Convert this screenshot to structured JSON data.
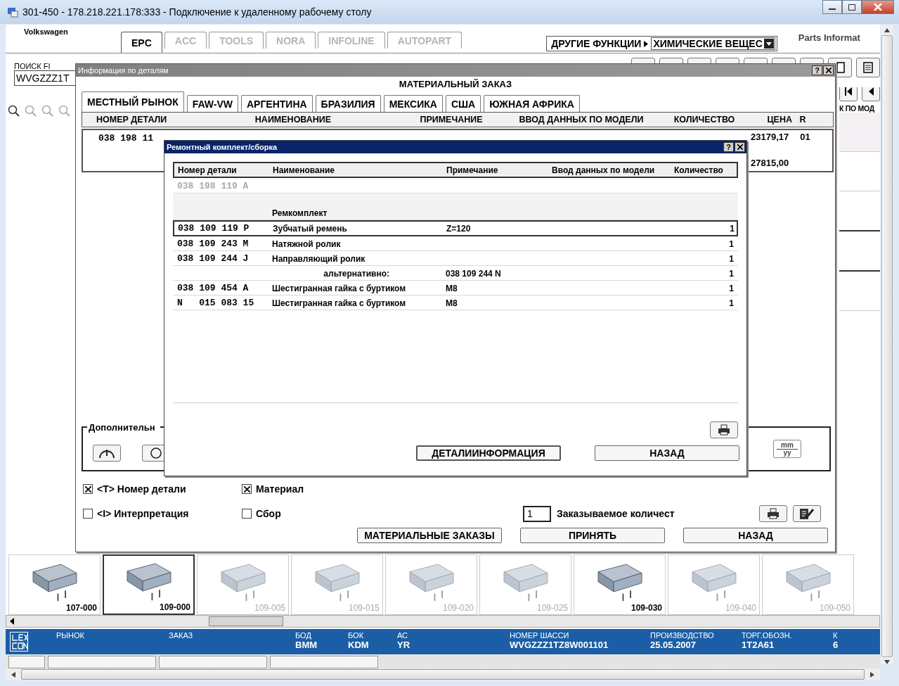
{
  "window": {
    "title": "301-450 - 178.218.221.178:333 - Подключение к удаленному рабочему столу"
  },
  "app": {
    "brand": "Volkswagen",
    "header_right": "Parts Informat",
    "other_functions": "ДРУГИЕ ФУНКЦИИ",
    "dropdown": {
      "value": "ХИМИЧЕСКИЕ ВЕЩЕС"
    },
    "tabs": [
      {
        "label": "EPC",
        "selected": true,
        "disabled": false
      },
      {
        "label": "ACC",
        "selected": false,
        "disabled": true
      },
      {
        "label": "TOOLS",
        "selected": false,
        "disabled": true
      },
      {
        "label": "NORA",
        "selected": false,
        "disabled": true
      },
      {
        "label": "INFOLINE",
        "selected": false,
        "disabled": true
      },
      {
        "label": "AUTOPART",
        "selected": false,
        "disabled": true
      }
    ],
    "search": {
      "label": "ПОИСК FI",
      "value": "WVGZZZ1T"
    },
    "side_column_header": "К ПО МОД"
  },
  "details_dialog": {
    "title": "Информация по деталям",
    "help_button": "?",
    "heading": "МАТЕРИАЛЬНЫЙ ЗАКАЗ",
    "tabs": [
      {
        "label": "МЕСТНЫЙ РЫНОК",
        "selected": true
      },
      {
        "label": "FAW-VW",
        "selected": false
      },
      {
        "label": "АРГЕНТИНА",
        "selected": false
      },
      {
        "label": "БРАЗИЛИЯ",
        "selected": false
      },
      {
        "label": "МЕКСИКА",
        "selected": false
      },
      {
        "label": "США",
        "selected": false
      },
      {
        "label": "ЮЖНАЯ АФРИКА",
        "selected": false
      }
    ],
    "columns": [
      "НОМЕР ДЕТАЛИ",
      "НАИМЕНОВАНИЕ",
      "ПРИМЕЧАНИЕ",
      "ВВОД ДАННЫХ ПО МОДЕЛИ",
      "КОЛИЧЕСТВО",
      "ЦЕНА",
      "R"
    ],
    "row": {
      "part_number": "038 198 11",
      "price": "23179,17",
      "r": "01",
      "price_2": "27815,00"
    },
    "extra_group_label": "Дополнительн",
    "date_format_button": {
      "top": "mm",
      "bottom": "yy"
    },
    "options": [
      {
        "label": "<T> Номер детали",
        "checked": true
      },
      {
        "label": "Материал",
        "checked": true
      },
      {
        "label": "<I> Интерпретация",
        "checked": false
      },
      {
        "label": "Сбор",
        "checked": false
      }
    ],
    "quantity": {
      "value": "1",
      "label": "Заказываемое количест"
    },
    "buttons": [
      "МАТЕРИАЛЬНЫЕ ЗАКАЗЫ",
      "ПРИНЯТЬ",
      "НАЗАД"
    ]
  },
  "kit_dialog": {
    "title": "Ремонтный комплект/сборка",
    "help_button": "?",
    "columns": [
      "Номер детали",
      "Наименование",
      "Примечание",
      "Ввод данных по модели",
      "Количество"
    ],
    "rows": [
      {
        "kind": "parent",
        "part": "038 198 119 A",
        "selected": false
      },
      {
        "kind": "group",
        "name": "Ремкомплект",
        "selected": false
      },
      {
        "kind": "item",
        "part": "038 109 119 P",
        "name": "Зубчатый ремень",
        "note": "Z=120",
        "qty": "1",
        "selected": true
      },
      {
        "kind": "item",
        "part": "038 109 243 M",
        "name": "Натяжной ролик",
        "qty": "1",
        "selected": false
      },
      {
        "kind": "item",
        "part": "038 109 244 J",
        "name": "Направляющий ролик",
        "qty": "1",
        "selected": false
      },
      {
        "kind": "alternative",
        "name": "альтернативно:",
        "note": "038 109 244 N",
        "qty": "1",
        "selected": false
      },
      {
        "kind": "item",
        "part": "038 109 454 A",
        "name": "Шестигранная гайка с буртиком",
        "note": "M8",
        "qty": "1",
        "selected": false
      },
      {
        "kind": "item",
        "part": "N   015 083 15",
        "name": "Шестигранная гайка с буртиком",
        "note": "M8",
        "qty": "1",
        "selected": false
      }
    ],
    "buttons": [
      "ДЕТАЛИИНФОРМАЦИЯ",
      "НАЗАД"
    ]
  },
  "thumbnails": [
    {
      "label": "107-000",
      "active": true,
      "selected": false
    },
    {
      "label": "109-000",
      "active": true,
      "selected": true
    },
    {
      "label": "109-005",
      "active": false,
      "selected": false
    },
    {
      "label": "109-015",
      "active": false,
      "selected": false
    },
    {
      "label": "109-020",
      "active": false,
      "selected": false
    },
    {
      "label": "109-025",
      "active": false,
      "selected": false
    },
    {
      "label": "109-030",
      "active": true,
      "selected": false
    },
    {
      "label": "109-040",
      "active": false,
      "selected": false
    },
    {
      "label": "109-050",
      "active": false,
      "selected": false
    }
  ],
  "status_bar": {
    "fields": [
      {
        "label": "РЫНОК"
      },
      {
        "label": "ЗАКАЗ"
      },
      {
        "label": "БОД",
        "value": "BMM"
      },
      {
        "label": "БОК",
        "value": "KDM"
      },
      {
        "label": "АС",
        "value": "YR"
      },
      {
        "label": "НОМЕР ШАССИ",
        "value": "WVGZZZ1TZ8W001101"
      },
      {
        "label": "ПРОИЗВОДСТВО",
        "value": "25.05.2007"
      },
      {
        "label": "ТОРГ.ОБОЗН.",
        "value": "1T2A61"
      },
      {
        "label": "К",
        "value": "6"
      }
    ]
  }
}
